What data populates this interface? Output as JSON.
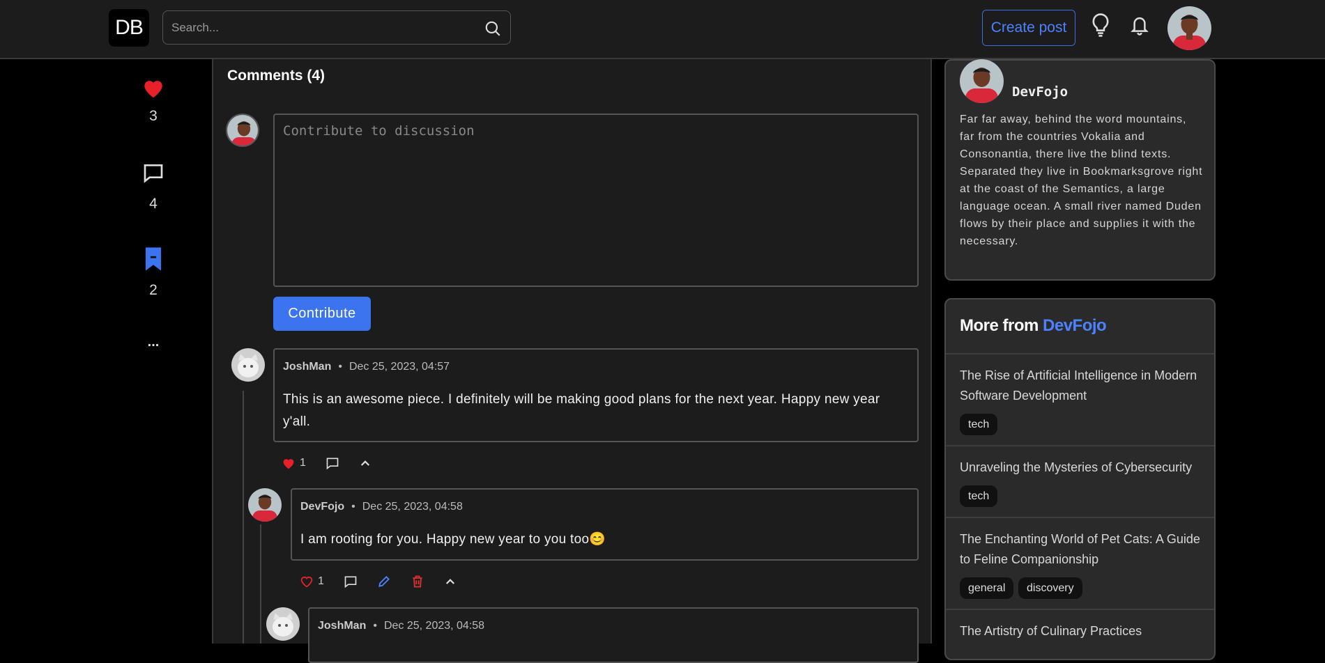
{
  "header": {
    "logo": "DB",
    "search_placeholder": "Search...",
    "create_post": "Create post",
    "icons": [
      "search-icon",
      "lightbulb-icon",
      "bell-icon"
    ]
  },
  "rail": {
    "likes": "3",
    "comments": "4",
    "bookmarks": "2",
    "more": "..."
  },
  "comments": {
    "title": "Comments (4)",
    "compose_placeholder": "Contribute to discussion",
    "contribute_label": "Contribute",
    "items": [
      {
        "author": "JoshMan",
        "date": "Dec 25, 2023, 04:57",
        "body": "This is an awesome piece. I definitely will be making good plans for the next year. Happy new year y'all.",
        "likes": "1"
      },
      {
        "author": "DevFojo",
        "date": "Dec 25, 2023, 04:58",
        "body": "I am rooting for you. Happy new year to you too😊",
        "likes": "1"
      },
      {
        "author": "JoshMan",
        "date": "Dec 25, 2023, 04:58"
      }
    ]
  },
  "author_card": {
    "name": "DevFojo",
    "bio": "Far far away, behind the word mountains, far from the countries Vokalia and Consonantia, there live the blind texts. Separated they live in Bookmarksgrove right at the coast of the Semantics, a large language ocean. A small river named Duden flows by their place and supplies it with the necessary."
  },
  "more_from": {
    "prefix": "More from",
    "author": "DevFojo",
    "posts": [
      {
        "title": "The Rise of Artificial Intelligence in Modern Software Development",
        "tags": [
          "tech"
        ]
      },
      {
        "title": "Unraveling the Mysteries of Cybersecurity",
        "tags": [
          "tech"
        ]
      },
      {
        "title": "The Enchanting World of Pet Cats: A Guide to Feline Companionship",
        "tags": [
          "general",
          "discovery"
        ]
      },
      {
        "title": "The Artistry of Culinary Practices",
        "tags": []
      }
    ]
  },
  "colors": {
    "accent": "#3c74f0",
    "like_red": "#e8202a",
    "delete_red": "#e03030",
    "edit_blue": "#4d82ff"
  }
}
